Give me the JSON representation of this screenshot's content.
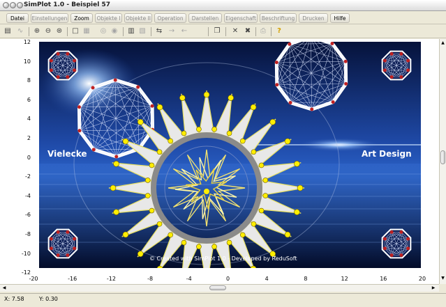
{
  "window": {
    "title": "SimPlot 1.0 - Beispiel 57"
  },
  "menu": [
    {
      "label": "Datei",
      "enabled": true
    },
    {
      "label": "Einstellungen",
      "enabled": false
    },
    {
      "label": "Zoom",
      "enabled": true
    },
    {
      "label": "Objekte I",
      "enabled": false
    },
    {
      "label": "Objekte II",
      "enabled": false
    },
    {
      "label": "Operation",
      "enabled": false
    },
    {
      "label": "Darstellen",
      "enabled": false
    },
    {
      "label": "Eigenschaft",
      "enabled": false
    },
    {
      "label": "Beschriftung",
      "enabled": false
    },
    {
      "label": "Drucken",
      "enabled": false
    },
    {
      "label": "Hilfe",
      "enabled": true
    }
  ],
  "toolbar": {
    "icons": [
      "calculator-icon",
      "curve-icon",
      "zoom-in-icon",
      "zoom-out-icon",
      "zoom-fit-icon",
      "frame-icon",
      "grid-icon",
      "circle-icon",
      "circle-filled-icon",
      "table-icon",
      "image-icon",
      "import-icon",
      "arrow-right-icon",
      "arrow-left-icon",
      "copy-icon",
      "delete-x-icon",
      "delete-all-icon",
      "print-icon",
      "help-icon"
    ]
  },
  "plot": {
    "y_ticks": [
      "12",
      "10",
      "8",
      "6",
      "4",
      "2",
      "0",
      "-2",
      "-4",
      "-6",
      "-8",
      "-10",
      "-12"
    ],
    "x_ticks": [
      "-20",
      "-16",
      "-12",
      "-8",
      "-4",
      "0",
      "4",
      "8",
      "12",
      "16",
      "20"
    ],
    "label_left": "Vielecke",
    "label_right": "Art Design",
    "credit": "© Created with SimPlot 1.0 - Developed by ReduSoft"
  },
  "status": {
    "x": "X: 7.58",
    "y": "Y: 0.30"
  },
  "colors": {
    "background_deep": "#0a1a4a",
    "background_light": "#2a5fc8",
    "star_fill": "#e8e8e8",
    "star_edge": "#e8e060",
    "vertex_dot": "#ffee00",
    "ring": "#8a8a8a",
    "polygon_vertex": "#c02020"
  }
}
